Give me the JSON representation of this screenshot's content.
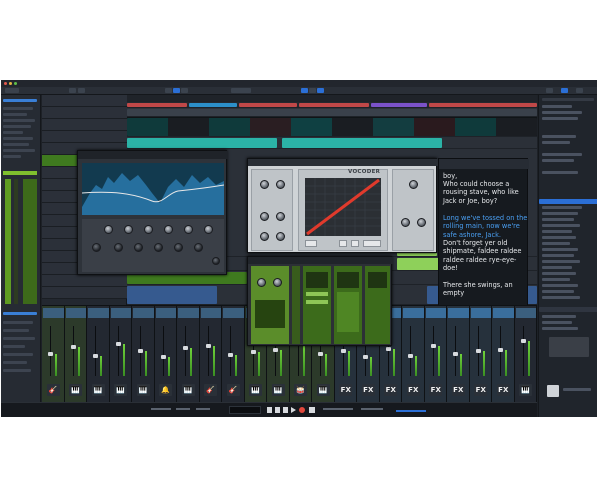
{
  "app": {
    "accent_colors": {
      "blue": "#2b6fd6",
      "green": "#7fbf2e",
      "teal": "#2bb3a7",
      "red": "#d94040"
    }
  },
  "vocoder": {
    "brand_label": "VOCODER"
  },
  "lyrics": {
    "lines": [
      "boy,",
      "Who could choose a rousing stave, who like Jack or Joe, boy?",
      "Long we've tossed on the rolling main, now we're safe ashore, Jack.",
      "Don't forget yer old shipmate, faldee raldee raldee raldee rye-eye-doe!",
      "There she swings, an empty"
    ],
    "highlight_color": "#4a9ff2"
  },
  "mixer": {
    "channel_icons": [
      {
        "name": "guitar-icon",
        "glyph": "🎸"
      },
      {
        "name": "keyboard-icon",
        "glyph": "🎹"
      },
      {
        "name": "keyboard-icon",
        "glyph": "🎹"
      },
      {
        "name": "keyboard-icon",
        "glyph": "🎹"
      },
      {
        "name": "keyboard-icon",
        "glyph": "🎹"
      },
      {
        "name": "bell-icon",
        "glyph": "🔔"
      },
      {
        "name": "keyboard-icon",
        "glyph": "🎹"
      },
      {
        "name": "bass-guitar-icon",
        "glyph": "🎸"
      },
      {
        "name": "guitar-icon",
        "glyph": "🎸"
      },
      {
        "name": "keyboard-icon",
        "glyph": "🎹"
      },
      {
        "name": "keyboard-icon",
        "glyph": "🎹"
      },
      {
        "name": "drums-icon",
        "glyph": "🥁"
      },
      {
        "name": "keyboard-icon",
        "glyph": "🎹"
      },
      {
        "name": "fx-label",
        "glyph": "FX"
      },
      {
        "name": "fx-label",
        "glyph": "FX"
      },
      {
        "name": "fx-label",
        "glyph": "FX"
      },
      {
        "name": "fx-label",
        "glyph": "FX"
      },
      {
        "name": "fx-label",
        "glyph": "FX"
      },
      {
        "name": "fx-label",
        "glyph": "FX"
      },
      {
        "name": "fx-label",
        "glyph": "FX"
      },
      {
        "name": "fx-label",
        "glyph": "FX"
      },
      {
        "name": "keyboard-icon",
        "glyph": "🎹"
      }
    ]
  }
}
